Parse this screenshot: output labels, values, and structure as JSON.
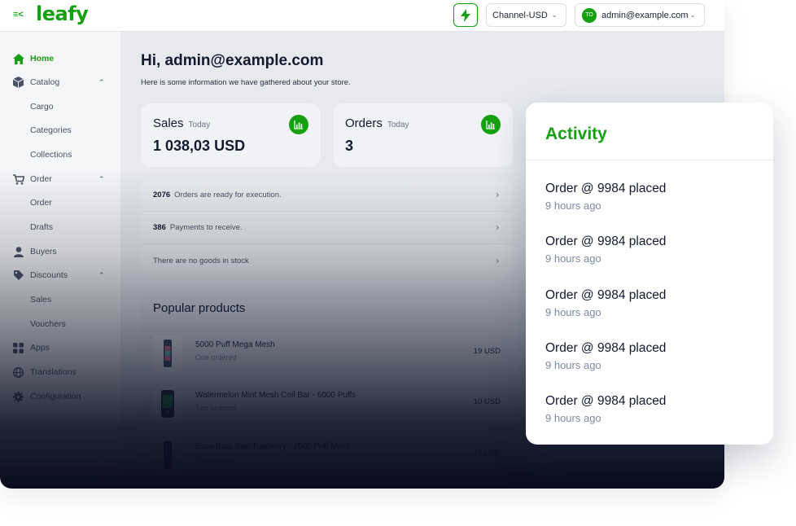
{
  "topbar": {
    "logo": "leafy",
    "menu_toggle_glyph": "≡<",
    "channel": "Channel-USD",
    "user_initials": "TO",
    "user_email": "admin@example.com"
  },
  "sidebar": {
    "home": "Home",
    "catalog": "Catalog",
    "cargo": "Cargo",
    "categories": "Categories",
    "collections": "Collections",
    "order_group": "Order",
    "order": "Order",
    "drafts": "Drafts",
    "buyers": "Buyers",
    "discounts": "Discounts",
    "sales": "Sales",
    "vouchers": "Vouchers",
    "apps": "Apps",
    "translations": "Translations",
    "configuration": "Configuration"
  },
  "main": {
    "greeting": "Hi, admin@example.com",
    "subtitle": "Here is some information we have gathered about your store.",
    "sales": {
      "title": "Sales",
      "period": "Today",
      "value": "1 038,03 USD"
    },
    "orders": {
      "title": "Orders",
      "period": "Today",
      "value": "3"
    },
    "notices": [
      {
        "count": "2076",
        "text": "Orders are ready for execution."
      },
      {
        "count": "386",
        "text": "Payments to receive."
      },
      {
        "count": "",
        "text": "There are no goods in stock"
      }
    ],
    "popular_title": "Popular products",
    "products": [
      {
        "name": "5000 Puff Mega Mesh",
        "sub": "One ordered",
        "price": "19 USD"
      },
      {
        "name": "Watermelon Mint Mesh Coil Bar - 6000 Puffs",
        "sub": "Two ordered",
        "price": "10 USD"
      },
      {
        "name": "Esco Bars Blue Rasberry - 2500 Puff Mesh",
        "sub": "Five ordered",
        "price": "19 USD"
      }
    ]
  },
  "activity": {
    "title": "Activity",
    "items": [
      {
        "text": "Order @ 9984 placed",
        "time": "9 hours ago"
      },
      {
        "text": "Order @ 9984 placed",
        "time": "9 hours ago"
      },
      {
        "text": "Order @ 9984 placed",
        "time": "9 hours ago"
      },
      {
        "text": "Order @ 9984 placed",
        "time": "9 hours ago"
      },
      {
        "text": "Order @ 9984 placed",
        "time": "9 hours ago"
      }
    ]
  },
  "colors": {
    "brand": "#14a010",
    "text": "#141a2e",
    "muted": "#7d8aa0"
  }
}
